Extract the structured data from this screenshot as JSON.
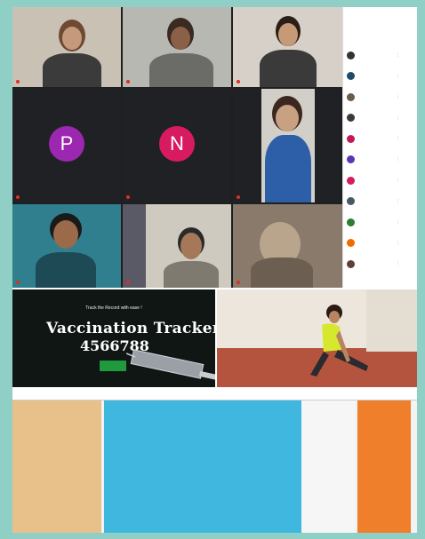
{
  "meet": {
    "tiles": [
      {
        "id": "t1",
        "name": "",
        "letter": ""
      },
      {
        "id": "t2",
        "name": "",
        "letter": ""
      },
      {
        "id": "t3",
        "name": "",
        "letter": ""
      },
      {
        "id": "t4",
        "name": "",
        "letter": "P"
      },
      {
        "id": "t5",
        "name": "",
        "letter": "N"
      },
      {
        "id": "t6",
        "name": "",
        "letter": ""
      },
      {
        "id": "t7",
        "name": "",
        "letter": ""
      },
      {
        "id": "t8",
        "name": "",
        "letter": ""
      },
      {
        "id": "t9",
        "name": "",
        "letter": ""
      }
    ],
    "colors": {
      "p_avatar": "#9c27b0",
      "n_avatar": "#d81b60",
      "mic_off": "#d93025"
    }
  },
  "participants_panel": {
    "title": "",
    "subtitle": "",
    "label": "",
    "rows": [
      {
        "name": "",
        "color": "#333333"
      },
      {
        "name": "",
        "color": "#1e4a6e"
      },
      {
        "name": "",
        "color": "#6b5b4a"
      },
      {
        "name": "",
        "color": "#3a3a3a"
      },
      {
        "name": "",
        "color": "#c2185b"
      },
      {
        "name": "",
        "color": "#5e35b1"
      },
      {
        "name": "",
        "color": "#d81b60"
      },
      {
        "name": "",
        "color": "#455a64"
      },
      {
        "name": "",
        "color": "#2e7d32"
      },
      {
        "name": "",
        "color": "#ef6c00"
      },
      {
        "name": "",
        "color": "#5d4037"
      }
    ]
  },
  "tracker": {
    "subtitle": "Track the Record with ease !",
    "title": "Vaccination Tracker",
    "count": "4566788",
    "button": ""
  },
  "table": {
    "headers": [
      "",
      "",
      "",
      ""
    ],
    "rows": [
      [
        "",
        "",
        "",
        ""
      ],
      [
        "",
        "",
        "",
        ""
      ],
      [
        "",
        "",
        "",
        ""
      ],
      [
        "",
        "",
        "",
        ""
      ],
      [
        "",
        "",
        "",
        ""
      ],
      [
        "",
        "",
        "",
        ""
      ],
      [
        "",
        "",
        "",
        ""
      ],
      [
        "",
        "",
        "",
        ""
      ],
      [
        "",
        "",
        "",
        ""
      ],
      [
        "",
        "",
        "",
        ""
      ],
      [
        "",
        "",
        "",
        ""
      ],
      [
        "",
        "",
        "",
        ""
      ],
      [
        "",
        "",
        "",
        ""
      ],
      [
        "",
        "",
        "",
        ""
      ],
      [
        "",
        "",
        "",
        ""
      ],
      [
        "",
        "",
        "",
        ""
      ],
      [
        "",
        "",
        "",
        ""
      ],
      [
        "",
        "",
        "",
        ""
      ],
      [
        "",
        "",
        "",
        ""
      ],
      [
        "",
        "",
        "",
        ""
      ],
      [
        "",
        "",
        "",
        ""
      ],
      [
        "",
        "",
        "",
        ""
      ],
      [
        "",
        "",
        "",
        ""
      ],
      [
        "",
        "",
        "",
        ""
      ],
      [
        "",
        "",
        "",
        ""
      ],
      [
        "",
        "",
        "",
        ""
      ],
      [
        "",
        "",
        "",
        ""
      ],
      [
        "",
        "",
        "",
        ""
      ],
      [
        "",
        "",
        "",
        ""
      ]
    ],
    "colors": {
      "col_a": "#e8c08a",
      "col_b": "#3fb7df",
      "col_d": "#ef7f2a"
    }
  }
}
